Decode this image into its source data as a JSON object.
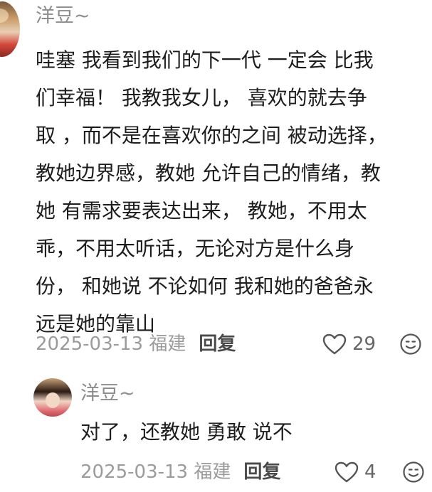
{
  "main_comment": {
    "username": "洋豆~",
    "content": "哇塞 我看到我们的下一代  一定会 比我\n们幸福！ 我教我女儿， 喜欢的就去争\n取 ，而不是在喜欢你的之间 被动选择，\n教她边界感，教她 允许自己的情绪，教\n她 有需求要表达出来， 教她，不用太\n乖，不用太听话，无论对方是什么身\n份， 和她说 不论如何 我和她的爸爸永\n远是她的靠山",
    "date_location": "2025-03-13 福建",
    "reply_label": "回复",
    "like_count": "29",
    "like_icon": "heart-outline-icon",
    "emoji_icon": "smiley-icon"
  },
  "reply_comment": {
    "username": "洋豆~",
    "content": "对了，还教她 勇敢 说不",
    "date_location": "2025-03-13 福建",
    "reply_label": "回复",
    "like_count": "4",
    "like_icon": "heart-outline-icon",
    "emoji_icon": "smiley-icon"
  },
  "colors": {
    "username": "#8c8c8c",
    "body_text": "#1d1d1d",
    "meta_text": "#9b9b9b",
    "reply_label": "#4a4a4a",
    "background": "#ffffff"
  }
}
